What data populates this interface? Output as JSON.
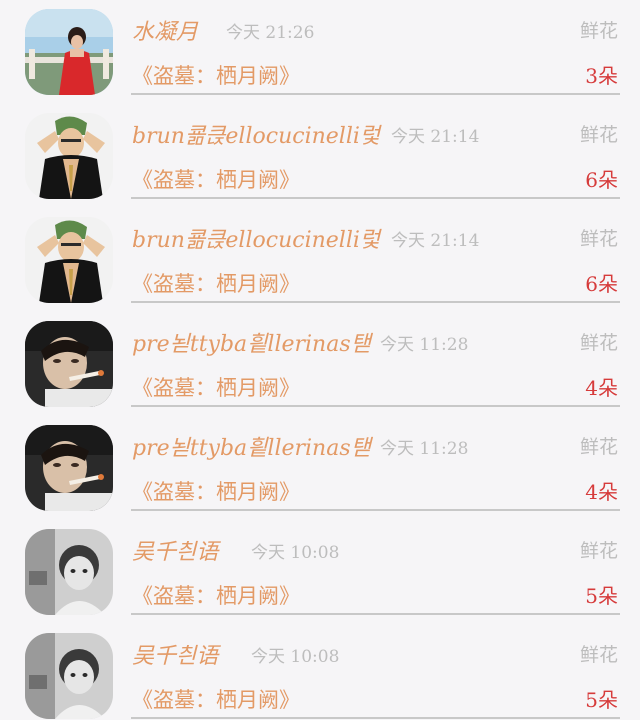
{
  "list": {
    "items": [
      {
        "name": "水凝月",
        "time": "今天  21:26",
        "gift_label": "鲜花",
        "subtitle": "《盗墓：栖月阙》",
        "count": "3朵",
        "avatar": "avatar-photo-woman-red-dress"
      },
      {
        "name": "brun쿎큱ellocucinelli렃",
        "time": "今天  21:14",
        "gift_label": "鲜花",
        "subtitle": "《盗墓：栖月阙》",
        "count": "6朵",
        "avatar": "avatar-anime-man-green-hair"
      },
      {
        "name": "brun쿎큱ellocucinelli렃",
        "time": "今天  21:14",
        "gift_label": "鲜花",
        "subtitle": "《盗墓：栖月阙》",
        "count": "6朵",
        "avatar": "avatar-anime-man-green-hair"
      },
      {
        "name": "pre뇓ttyba힅llerinas탣",
        "time": "今天  11:28",
        "gift_label": "鲜花",
        "subtitle": "《盗墓：栖月阙》",
        "count": "4朵",
        "avatar": "avatar-photo-man-smoking"
      },
      {
        "name": "pre뇓ttyba힅llerinas탣",
        "time": "今天  11:28",
        "gift_label": "鲜花",
        "subtitle": "《盗墓：栖月阙》",
        "count": "4朵",
        "avatar": "avatar-photo-man-smoking"
      },
      {
        "name": "吴千칀语",
        "time": "今天  10:08",
        "gift_label": "鲜花",
        "subtitle": "《盗墓：栖月阙》",
        "count": "5朵",
        "avatar": "avatar-photo-child-bw"
      },
      {
        "name": "吴千칀语",
        "time": "今天  10:08",
        "gift_label": "鲜花",
        "subtitle": "《盗墓：栖月阙》",
        "count": "5朵",
        "avatar": "avatar-photo-child-bw"
      }
    ]
  },
  "colors": {
    "name": "#e39a66",
    "subtitle": "#e39a66",
    "muted": "#bdbdbd",
    "count": "#d63b3b",
    "background": "#f6f5f7"
  }
}
